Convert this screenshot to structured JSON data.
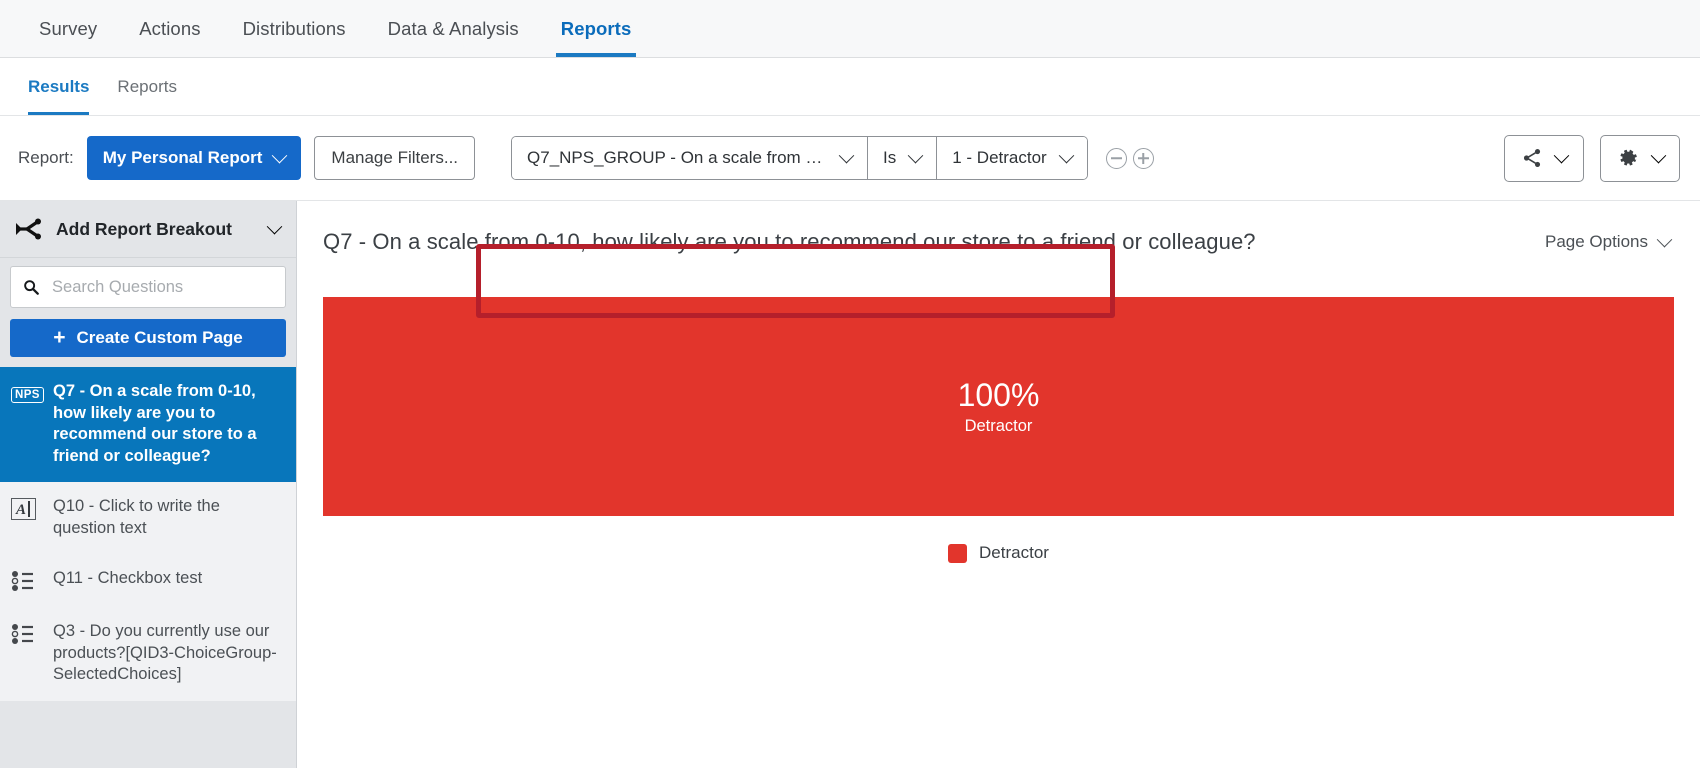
{
  "topnav": {
    "items": [
      {
        "label": "Survey",
        "active": false
      },
      {
        "label": "Actions",
        "active": false
      },
      {
        "label": "Distributions",
        "active": false
      },
      {
        "label": "Data & Analysis",
        "active": false
      },
      {
        "label": "Reports",
        "active": true
      }
    ]
  },
  "subnav": {
    "items": [
      {
        "label": "Results",
        "active": true
      },
      {
        "label": "Reports",
        "active": false
      }
    ]
  },
  "toolbar": {
    "report_label": "Report:",
    "report_select": "My Personal Report",
    "manage_filters": "Manage Filters...",
    "filter": {
      "field": "Q7_NPS_GROUP - On a scale from 0-1...",
      "operator": "Is",
      "value": "1 - Detractor"
    },
    "minus_icon": "minus-circle-icon",
    "plus_icon": "plus-circle-icon",
    "share_icon": "share-icon",
    "settings_icon": "gear-icon",
    "annotation_color": "#b51f2b"
  },
  "sidebar": {
    "breakout": {
      "label": "Add Report Breakout",
      "icon": "breakout-branch-icon"
    },
    "search": {
      "placeholder": "Search Questions",
      "value": "",
      "icon": "search-icon"
    },
    "create_page": {
      "label": "Create Custom Page",
      "icon": "plus-icon"
    },
    "questions": [
      {
        "badge": "NPS",
        "icon": "nps-badge-icon",
        "label": "Q7 - On a scale from 0-10, how likely are you to recommend our store to a friend or colleague?",
        "selected": true
      },
      {
        "badge": "",
        "icon": "text-entry-icon",
        "label": "Q10 - Click to write the question text",
        "selected": false
      },
      {
        "badge": "",
        "icon": "multiple-choice-icon",
        "label": "Q11 - Checkbox test",
        "selected": false
      },
      {
        "badge": "",
        "icon": "multiple-choice-icon",
        "label": "Q3 - Do you currently use our products?[QID3-ChoiceGroup-SelectedChoices]",
        "selected": false
      }
    ]
  },
  "main": {
    "title": "Q7 - On a scale from 0-10, how likely are you to recommend our store to a friend or colleague?",
    "page_options": "Page Options"
  },
  "chart_data": {
    "type": "bar",
    "orientation": "stacked-horizontal-100",
    "title": "Q7 - On a scale from 0-10, how likely are you to recommend our store to a friend or colleague?",
    "categories": [
      "Detractor"
    ],
    "values": [
      100
    ],
    "value_labels": [
      "100%"
    ],
    "segment_sublabel": "Detractor",
    "colors": [
      "#e2352c"
    ],
    "legend": [
      {
        "label": "Detractor",
        "color": "#e2352c"
      }
    ],
    "legend_position": "bottom-center",
    "xlabel": "",
    "ylabel": "",
    "ylim": [
      0,
      100
    ],
    "grid": false
  }
}
